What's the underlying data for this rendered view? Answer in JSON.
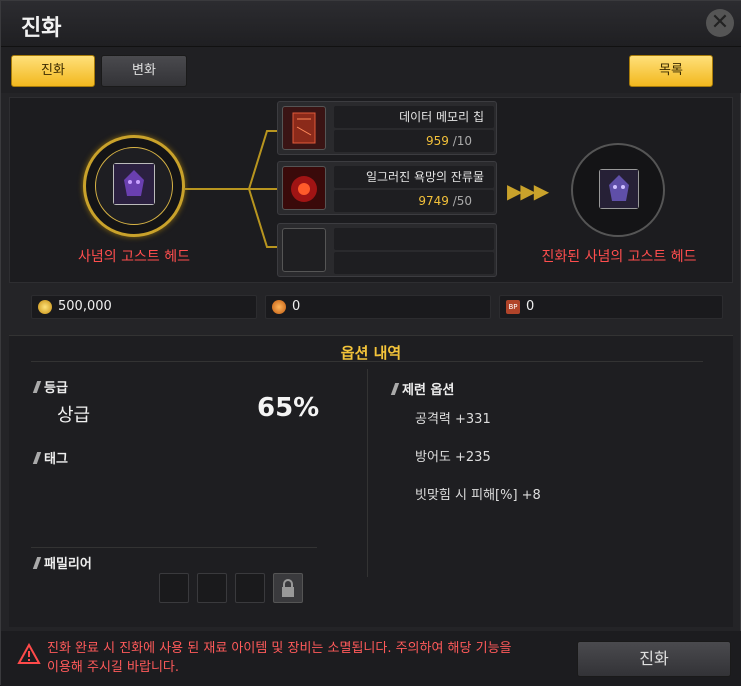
{
  "window": {
    "title": "진화"
  },
  "tabs": {
    "evolve": "진화",
    "transform": "변화",
    "list": "목록"
  },
  "craft": {
    "source_name": "사념의 고스트 헤드",
    "result_name": "진화된 사념의 고스트 헤드",
    "arrows": "▶▶▶",
    "materials": [
      {
        "name": "데이터 메모리 칩",
        "have": "959",
        "need": "/10"
      },
      {
        "name": "일그러진 욕망의 잔류물",
        "have": "9749",
        "need": "/50"
      }
    ]
  },
  "currency": [
    {
      "icon": "gold-coin-icon",
      "value": "500,000"
    },
    {
      "icon": "orange-coin-icon",
      "value": "0"
    },
    {
      "icon": "bp-icon",
      "value": "0",
      "badge": "BP"
    }
  ],
  "options": {
    "title": "옵션 내역",
    "grade_label": "등급",
    "grade_value": "상급",
    "grade_percent": "65%",
    "tag_label": "태그",
    "familiar_label": "패밀리어",
    "refine_label": "제련 옵션",
    "refine_lines": [
      "공격력 +331",
      "방어도 +235",
      "빗맞힘 시 피해[%] +8"
    ]
  },
  "footer": {
    "warning": "진화 완료 시 진화에 사용 된 재료 아이템 및 장비는 소멸됩니다. 주의하여 해당 기능을 이용해 주시길 바랍니다.",
    "evolve_button": "진화"
  },
  "colors": {
    "accent": "#f2b81e",
    "warning": "#ff5a5a",
    "name_red": "#ff4e4e"
  }
}
